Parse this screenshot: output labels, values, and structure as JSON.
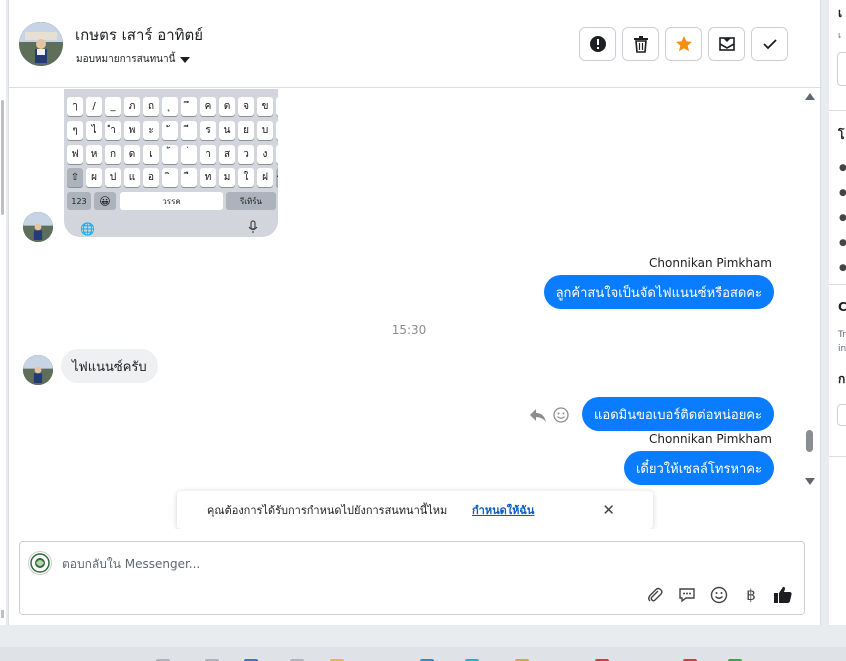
{
  "header": {
    "contact_name": "เกษตร เสาร์ อาทิตย์",
    "assign_label": "มอบหมายการสนทนานี้",
    "actions": [
      {
        "name": "mark-spam",
        "icon": "exclamation-circle-icon"
      },
      {
        "name": "delete",
        "icon": "trash-icon"
      },
      {
        "name": "star",
        "icon": "star-icon",
        "color": "#f4900c"
      },
      {
        "name": "mark-unread",
        "icon": "envelope-icon"
      },
      {
        "name": "mark-done",
        "icon": "checkmark-icon"
      }
    ]
  },
  "keyboard_image": {
    "rows": [
      [
        "ๅ",
        "/",
        "_",
        "ภ",
        "ถ",
        "ุ",
        "ึ",
        "ค",
        "ต",
        "จ",
        "ข",
        "ช"
      ],
      [
        "ๆ",
        "ไ",
        "ำ",
        "พ",
        "ะ",
        "ั",
        "ี",
        "ร",
        "น",
        "ย",
        "บ",
        "ล"
      ],
      [
        "ฟ",
        "ห",
        "ก",
        "ด",
        "เ",
        "้",
        "่",
        "า",
        "ส",
        "ว",
        "ง",
        "ฃ"
      ],
      [
        "⇧",
        "ผ",
        "ป",
        "แ",
        "อ",
        "ิ",
        "ื",
        "ท",
        "ม",
        "ใ",
        "ฝ",
        "⌫"
      ]
    ],
    "num_key": "123",
    "emoji_key": "😀",
    "space_key": "วรรค",
    "return_key": "รีเทิร์น"
  },
  "messages": [
    {
      "sender": "Chonnikan Pimkham",
      "text": "ลูกค้าสนใจเป็นจัดไฟแนนซ์หรือสดคะ"
    },
    {
      "timestamp": "15:30"
    },
    {
      "text": "ไฟแนนซ์ครับ"
    },
    {
      "text": "แอดมินขอเบอร์ติดต่อหน่อยคะ"
    },
    {
      "sender": "Chonnikan Pimkham",
      "text": "เดี๋ยวให้เซลล์โทรหาคะ"
    }
  ],
  "banner": {
    "text": "คุณต้องการได้รับการกำหนดไปยังการสนทนานี้ไหม",
    "link": "กำหนดให้ฉัน",
    "close": "✕"
  },
  "composer": {
    "placeholder": "ตอบกลับใน Messenger...",
    "tools": [
      "paperclip-icon",
      "saved-reply-icon",
      "emoji-icon",
      "baht-icon",
      "thumbs-up-icon"
    ]
  },
  "right_panel": {
    "fragments": [
      "เ",
      "โ",
      "C",
      "Tr",
      "in",
      "ก"
    ]
  },
  "colors": {
    "accent": "#0a7cff",
    "link": "#0a5cc2",
    "star": "#f4900c"
  }
}
